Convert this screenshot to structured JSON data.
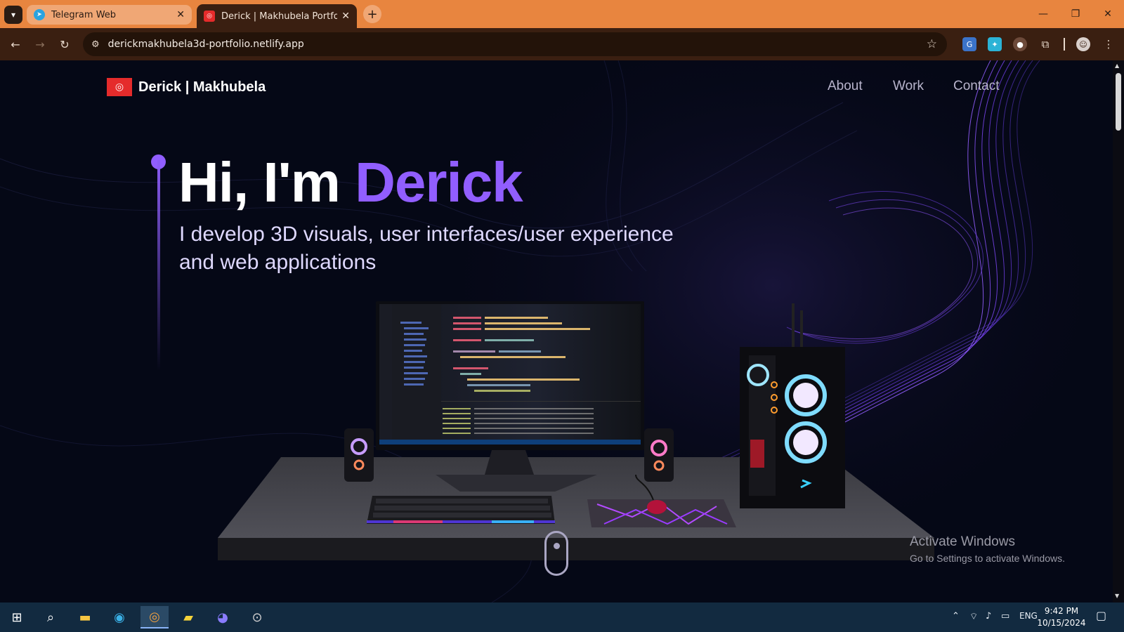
{
  "browser": {
    "tabs": [
      {
        "title": "Telegram Web",
        "favicon": "telegram-icon",
        "active": false
      },
      {
        "title": "Derick | Makhubela Portfolio",
        "favicon": "portfolio-logo-icon",
        "active": true
      }
    ],
    "url": "derickmakhubela3d-portfolio.netlify.app",
    "theme_color": "#e8853f"
  },
  "site": {
    "logo_text": "Derick | Makhubela",
    "nav": [
      "About",
      "Work",
      "Contact"
    ],
    "hero": {
      "greeting": "Hi, I'm ",
      "name": "Derick",
      "subtitle": "I develop 3D visuals, user interfaces/user experience and web applications"
    },
    "accent_color": "#915eff",
    "background_color": "#050816"
  },
  "watermark": {
    "title": "Activate Windows",
    "subtitle": "Go to Settings to activate Windows."
  },
  "taskbar": {
    "language": "ENG",
    "time": "9:42 PM",
    "date": "10/15/2024"
  }
}
